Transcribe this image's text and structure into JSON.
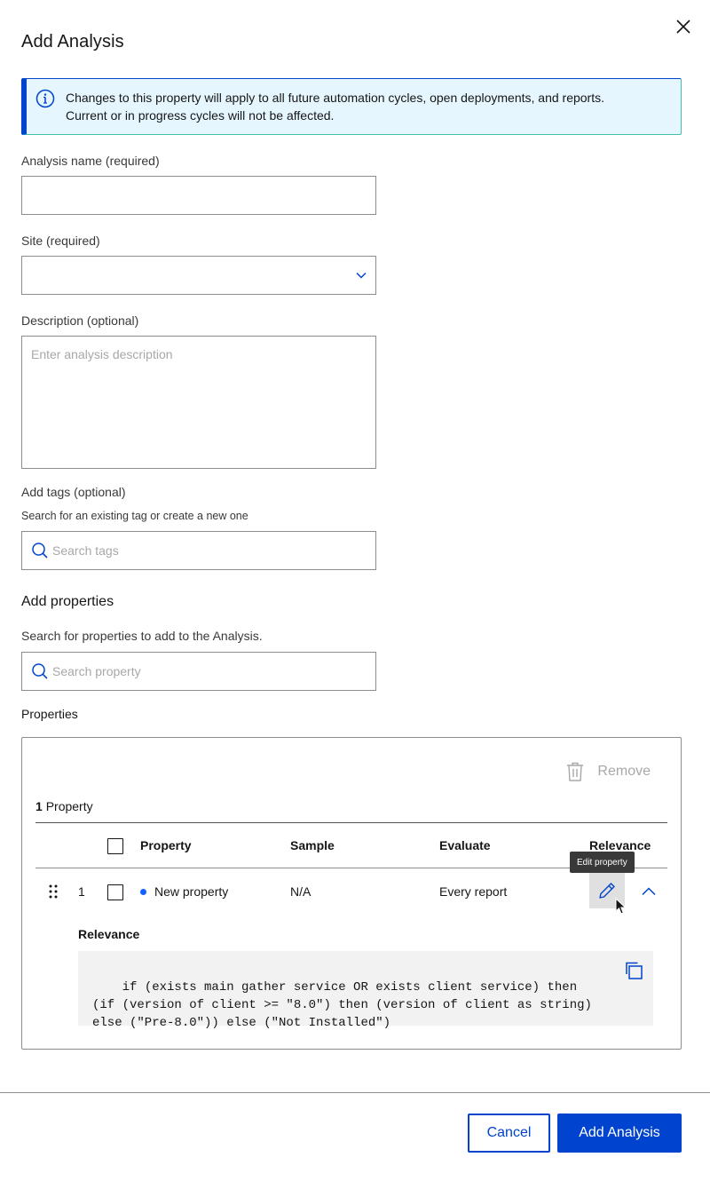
{
  "modal": {
    "title": "Add Analysis",
    "close_icon": "close-icon"
  },
  "banner": {
    "icon": "info-icon",
    "line1": "Changes to this property will apply to all future automation cycles, open deployments, and reports.",
    "line2": "Current or in progress cycles will not be affected."
  },
  "form": {
    "analysis_name": {
      "label": "Analysis name (required)",
      "value": ""
    },
    "site": {
      "label": "Site (required)",
      "value": ""
    },
    "description": {
      "label": "Description (optional)",
      "placeholder": "Enter analysis description"
    },
    "tags": {
      "label": "Add tags (optional)",
      "helper": "Search for an existing tag or create a new one",
      "placeholder": "Search tags"
    }
  },
  "add_properties": {
    "title": "Add properties",
    "helper": "Search for properties to add to the Analysis.",
    "placeholder": "Search property"
  },
  "properties": {
    "label": "Properties",
    "remove_label": "Remove",
    "count_number": "1",
    "count_label": "Property",
    "columns": [
      "Property",
      "Sample",
      "Evaluate",
      "Relevance"
    ],
    "rows": [
      {
        "index": "1",
        "name": "New property",
        "sample": "N/A",
        "evaluate": "Every report",
        "status_color": "#0f62fe"
      }
    ],
    "tooltip": "Edit property",
    "expanded": {
      "label": "Relevance",
      "code": "if (exists main gather service OR exists client service) then (if (version of client >= \"8.0\") then (version of client as string) else (\"Pre-8.0\")) else (\"Not Installed\")"
    }
  },
  "footer": {
    "cancel_label": "Cancel",
    "submit_label": "Add Analysis"
  },
  "colors": {
    "primary": "#0043ce",
    "banner_bg": "#e5f6ff"
  }
}
